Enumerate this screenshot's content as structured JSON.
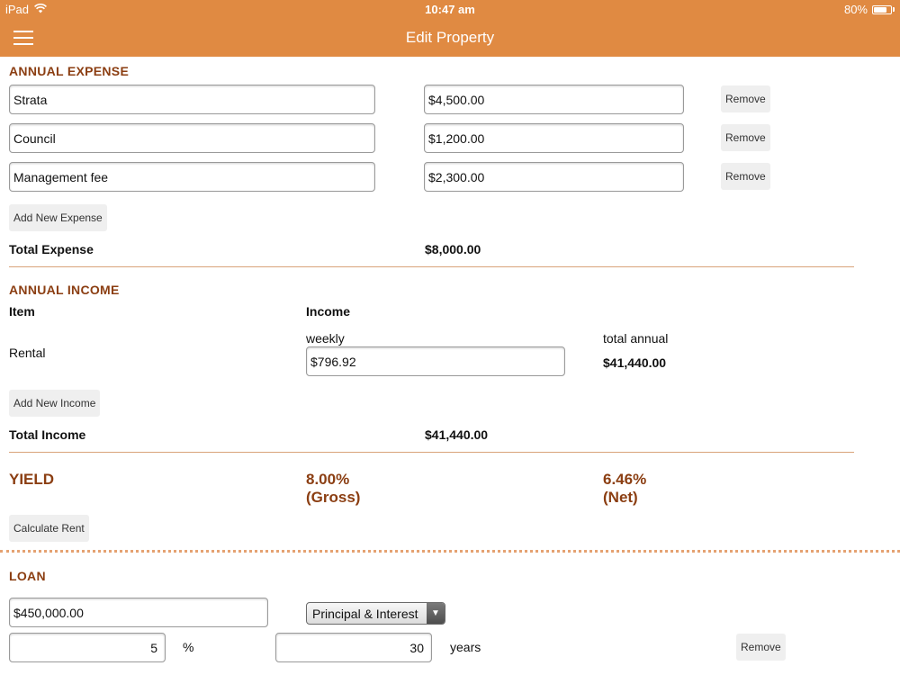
{
  "status": {
    "device": "iPad",
    "time": "10:47 am",
    "battery": "80%",
    "battery_level": 0.8
  },
  "nav": {
    "title": "Edit Property"
  },
  "expense": {
    "title": "ANNUAL EXPENSE",
    "items": [
      {
        "name": "Strata",
        "amount": "$4,500.00",
        "remove": "Remove"
      },
      {
        "name": "Council",
        "amount": "$1,200.00",
        "remove": "Remove"
      },
      {
        "name": "Management fee",
        "amount": "$2,300.00",
        "remove": "Remove"
      }
    ],
    "add_label": "Add New Expense",
    "total_label": "Total Expense",
    "total_value": "$8,000.00"
  },
  "income": {
    "title": "ANNUAL INCOME",
    "col_item": "Item",
    "col_income": "Income",
    "weekly_label": "weekly",
    "total_annual_label": "total annual",
    "rental_label": "Rental",
    "weekly_value": "$796.92",
    "annual_value": "$41,440.00",
    "add_label": "Add New Income",
    "total_label": "Total Income",
    "total_value": "$41,440.00"
  },
  "yield": {
    "title": "YIELD",
    "gross_value": "8.00%",
    "gross_label": "(Gross)",
    "net_value": "6.46%",
    "net_label": "(Net)",
    "calc_label": "Calculate Rent"
  },
  "loan": {
    "title": "LOAN",
    "amount": "$450,000.00",
    "type_selected": "Principal & Interest",
    "rate": "5",
    "rate_unit": "%",
    "term": "30",
    "term_unit": "years",
    "remove": "Remove"
  }
}
